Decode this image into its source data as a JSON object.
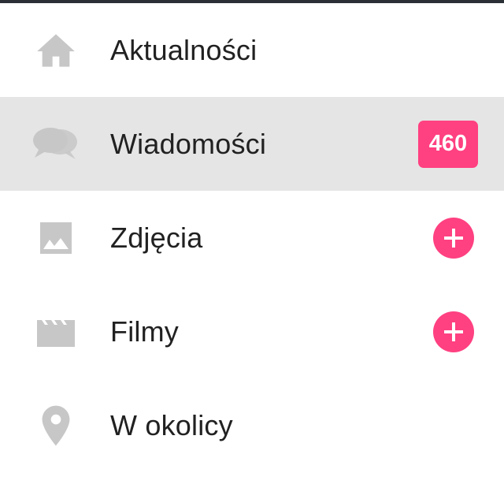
{
  "colors": {
    "accent": "#ff4081",
    "icon": "#c7c7c7",
    "active_bg": "#e5e5e5",
    "text": "#212121"
  },
  "menu": {
    "items": [
      {
        "label": "Aktualności",
        "icon": "home-icon",
        "active": false
      },
      {
        "label": "Wiadomości",
        "icon": "chat-icon",
        "active": true,
        "badge": "460"
      },
      {
        "label": "Zdjęcia",
        "icon": "image-icon",
        "active": false,
        "action": "add-icon"
      },
      {
        "label": "Filmy",
        "icon": "film-icon",
        "active": false,
        "action": "add-icon"
      },
      {
        "label": "W okolicy",
        "icon": "location-pin-icon",
        "active": false
      }
    ]
  }
}
